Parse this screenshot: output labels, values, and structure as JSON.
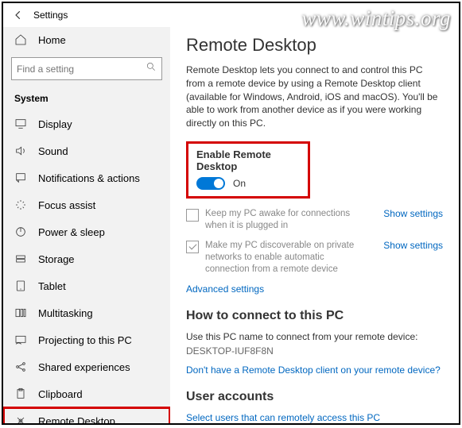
{
  "watermark": "www.wintips.org",
  "header": {
    "title": "Settings"
  },
  "sidebar": {
    "home": "Home",
    "search_placeholder": "Find a setting",
    "section": "System",
    "items": [
      {
        "label": "Display"
      },
      {
        "label": "Sound"
      },
      {
        "label": "Notifications & actions"
      },
      {
        "label": "Focus assist"
      },
      {
        "label": "Power & sleep"
      },
      {
        "label": "Storage"
      },
      {
        "label": "Tablet"
      },
      {
        "label": "Multitasking"
      },
      {
        "label": "Projecting to this PC"
      },
      {
        "label": "Shared experiences"
      },
      {
        "label": "Clipboard"
      },
      {
        "label": "Remote Desktop"
      }
    ]
  },
  "main": {
    "title": "Remote Desktop",
    "desc": "Remote Desktop lets you connect to and control this PC from a remote device by using a Remote Desktop client (available for Windows, Android, iOS and macOS). You'll be able to work from another device as if you were working directly on this PC.",
    "enable_h": "Enable Remote Desktop",
    "toggle_state": "On",
    "chk1": "Keep my PC awake for connections when it is plugged in",
    "chk2": "Make my PC discoverable on private networks to enable automatic connection from a remote device",
    "show_settings": "Show settings",
    "adv": "Advanced settings",
    "connect_h": "How to connect to this PC",
    "connect_desc": "Use this PC name to connect from your remote device:",
    "pc_name": "DESKTOP-IUF8F8N",
    "no_client": "Don't have a Remote Desktop client on your remote device?",
    "users_h": "User accounts",
    "users_link": "Select users that can remotely access this PC"
  }
}
